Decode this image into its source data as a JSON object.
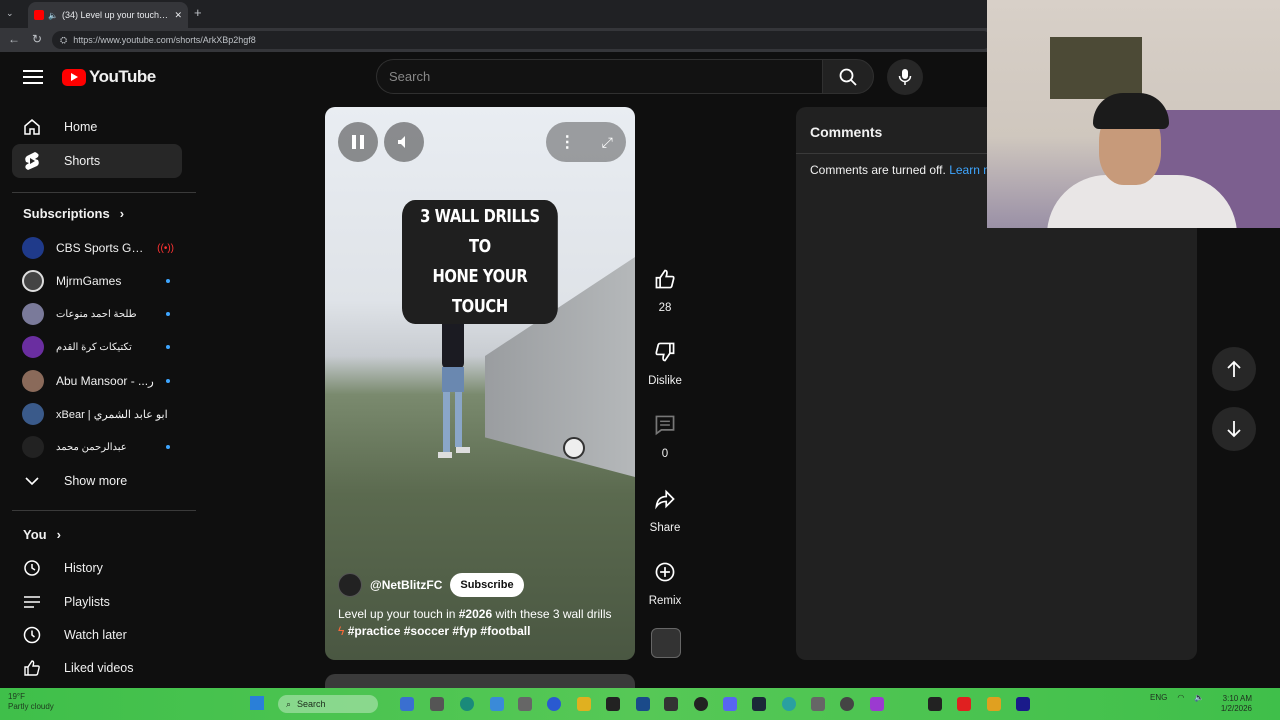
{
  "browser": {
    "tab_title": "(34) Level up your touch in #2026",
    "url": "https://www.youtube.com/shorts/ArkXBp2hgf8"
  },
  "header": {
    "logo_text": "YouTube",
    "search_placeholder": "Search"
  },
  "sidebar": {
    "primary": [
      {
        "label": "Home",
        "icon": "home-icon"
      },
      {
        "label": "Shorts",
        "icon": "shorts-icon",
        "active": true
      }
    ],
    "subscriptions_title": "Subscriptions",
    "subscriptions": [
      {
        "name": "CBS Sports Gola...",
        "color": "#1f3a8a",
        "indicator": "live"
      },
      {
        "name": "MjrmGames",
        "color": "#444444",
        "indicator": "dot"
      },
      {
        "name": "طلحة احمد منوعات",
        "color": "#7a7a9a",
        "indicator": "dot"
      },
      {
        "name": "تكتيكات كرة القدم",
        "color": "#6a2ea0",
        "indicator": "dot"
      },
      {
        "name": "Abu Mansoor - ...ر",
        "color": "#8a6a5a",
        "indicator": "dot"
      },
      {
        "name": "xBear | ابو عابد الشمري",
        "color": "#3a5a8a",
        "indicator": "none"
      },
      {
        "name": "عبدالرحمن محمد",
        "color": "#222222",
        "indicator": "dot"
      }
    ],
    "show_more": "Show more",
    "you_title": "You",
    "you_items": [
      {
        "label": "History",
        "icon": "history-icon"
      },
      {
        "label": "Playlists",
        "icon": "playlists-icon"
      },
      {
        "label": "Watch later",
        "icon": "watch-later-icon"
      },
      {
        "label": "Liked videos",
        "icon": "liked-videos-icon"
      }
    ]
  },
  "video": {
    "overlay_line1": "3 WALL DRILLS TO",
    "overlay_line2": "HONE YOUR TOUCH",
    "channel": "@NetBlitzFC",
    "subscribe": "Subscribe",
    "caption_line1_pre": "Level up your touch in ",
    "caption_tag1": "#2026",
    "caption_line1_post": " with these 3 wall drills",
    "caption_line2": "#practice #soccer #fyp #football"
  },
  "actions": {
    "likes": "28",
    "dislike": "Dislike",
    "comments": "0",
    "share": "Share",
    "remix": "Remix"
  },
  "comments_panel": {
    "title": "Comments",
    "message": "Comments are turned off.",
    "link": "Learn m"
  },
  "taskbar": {
    "weather_temp": "19°F",
    "weather_desc": "Partly cloudy",
    "search": "Search",
    "lang": "ENG",
    "time": "3:10 AM",
    "date": "1/2/2026"
  },
  "colors": {
    "accent_red": "#ff0000",
    "link_blue": "#3ea6ff",
    "taskbar_green": "#4cc44f"
  }
}
